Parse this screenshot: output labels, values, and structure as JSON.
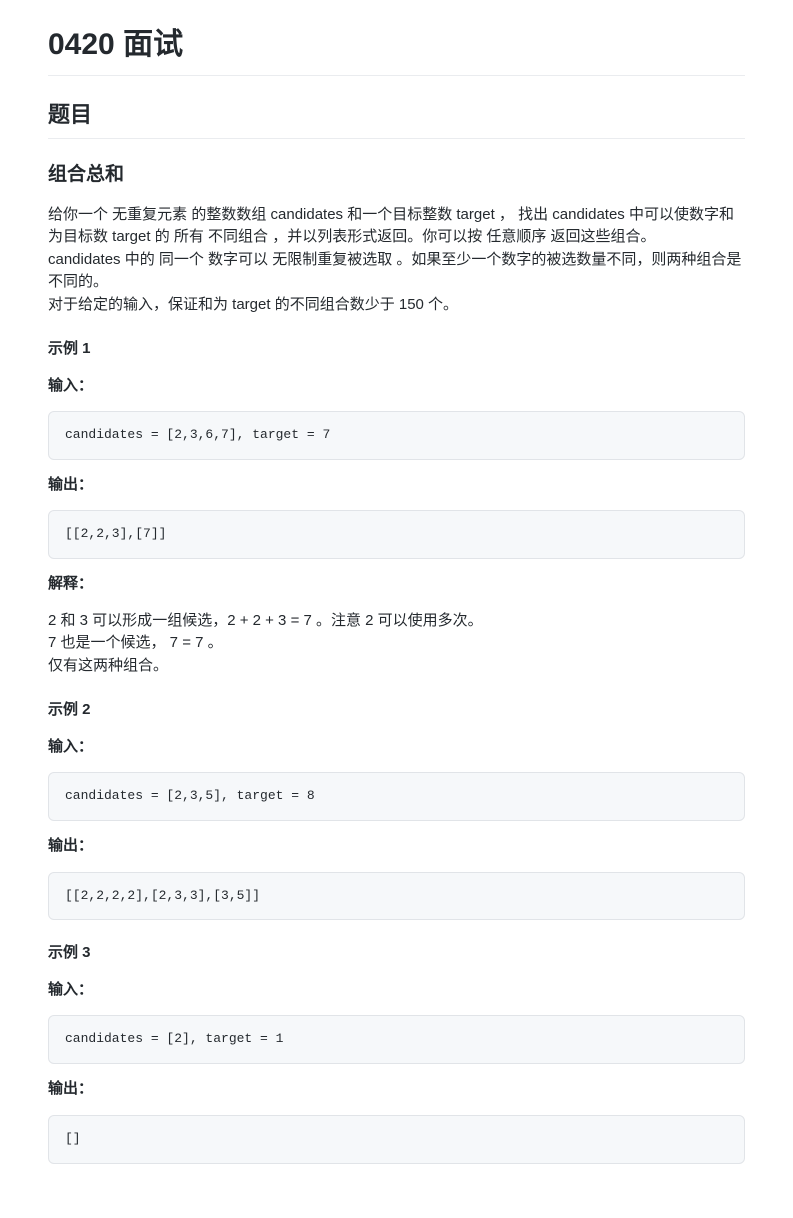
{
  "title": "0420 面试",
  "section": "题目",
  "subtitle": "组合总和",
  "intro": [
    "给你一个 无重复元素 的整数数组 candidates 和一个目标整数 target ， 找出 candidates 中可以使数字和为目标数 target 的 所有 不同组合 ，并以列表形式返回。你可以按 任意顺序 返回这些组合。",
    "candidates 中的 同一个 数字可以 无限制重复被选取 。如果至少一个数字的被选数量不同，则两种组合是不同的。",
    "对于给定的输入，保证和为 target 的不同组合数少于 150 个。"
  ],
  "labels": {
    "input": "输入：",
    "output": "输出：",
    "explain": "解释："
  },
  "examples": [
    {
      "heading": "示例 1",
      "input": "candidates = [2,3,6,7], target = 7",
      "output": "[[2,2,3],[7]]",
      "explain": [
        "2 和 3 可以形成一组候选，2 + 2 + 3 = 7 。注意 2 可以使用多次。",
        "7 也是一个候选， 7 = 7 。",
        "仅有这两种组合。"
      ]
    },
    {
      "heading": "示例 2",
      "input": "candidates = [2,3,5], target = 8",
      "output": "[[2,2,2,2],[2,3,3],[3,5]]"
    },
    {
      "heading": "示例 3",
      "input": "candidates = [2], target = 1",
      "output": "[]"
    }
  ]
}
